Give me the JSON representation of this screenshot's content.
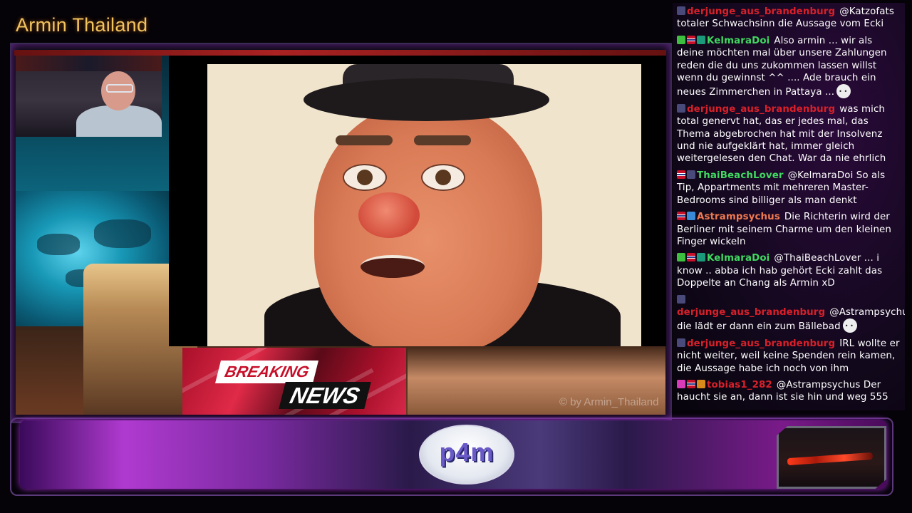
{
  "window": {
    "title": "Armin Thailand"
  },
  "overlay": {
    "breaking_word": "BREAKING",
    "news_word": "NEWS",
    "watermark": "© by Armin_Thailand",
    "logo_text": "p4m"
  },
  "chat": {
    "messages": [
      {
        "user": "derjunge_aus_brandenburg",
        "color": "#d8202a",
        "badges": [
          "sub"
        ],
        "text": "@Katzofats totaler Schwachsinn die Aussage vom Ecki"
      },
      {
        "user": "KelmaraDoi",
        "color": "#40d860",
        "badges": [
          "check",
          "flag",
          "gift"
        ],
        "text": "Also armin ... wir als deine möchten mal über unsere Zahlungen reden die du uns zukommen lassen willst wenn du gewinnst ^^ .... Ade brauch ein neues Zimmerchen in Pattaya ...",
        "emote": true
      },
      {
        "user": "derjunge_aus_brandenburg",
        "color": "#d8202a",
        "badges": [
          "sub"
        ],
        "text": "was mich total genervt hat, das er jedes mal, das Thema abgebrochen hat mit der Insolvenz und nie aufgeklärt hat, immer gleich weitergelesen den Chat. War da nie ehrlich"
      },
      {
        "user": "ThaiBeachLover",
        "color": "#40d860",
        "badges": [
          "flag",
          "sub"
        ],
        "text": "@KelmaraDoi So als Tip, Appartments mit mehreren Master-Bedrooms sind billiger als man denkt"
      },
      {
        "user": "Astrampsychus",
        "color": "#f07a50",
        "badges": [
          "flag",
          "crown"
        ],
        "text": "Die Richterin wird der Berliner mit seinem Charme um den kleinen Finger wickeln"
      },
      {
        "user": "KelmaraDoi",
        "color": "#40d860",
        "badges": [
          "check",
          "flag",
          "gift"
        ],
        "text": "@ThaiBeachLover ... i know .. abba ich hab gehört Ecki zahlt das Doppelte an Chang als Armin xD"
      },
      {
        "user": "derjunge_aus_brandenburg",
        "color": "#d8202a",
        "badges": [
          "sub"
        ],
        "text": "@Astrampsychus die lädt er dann ein zum Bällebad",
        "emote": true
      },
      {
        "user": "derjunge_aus_brandenburg",
        "color": "#d8202a",
        "badges": [
          "sub"
        ],
        "text": "IRL wollte er nicht weiter, weil keine Spenden rein kamen, die Aussage habe ich noch von ihm"
      },
      {
        "user": "tobias1_282",
        "color": "#d8202a",
        "badges": [
          "heart",
          "flag",
          "sun"
        ],
        "text": "@Astrampsychus Der haucht sie an, dann ist sie hin und weg 555"
      }
    ]
  },
  "icons": {
    "sub": "sub-badge-icon",
    "check": "check-badge-icon",
    "flag": "thai-flag-icon",
    "gift": "gift-badge-icon",
    "crown": "crown-badge-icon",
    "heart": "heart-badge-icon",
    "sun": "sun-badge-icon"
  }
}
